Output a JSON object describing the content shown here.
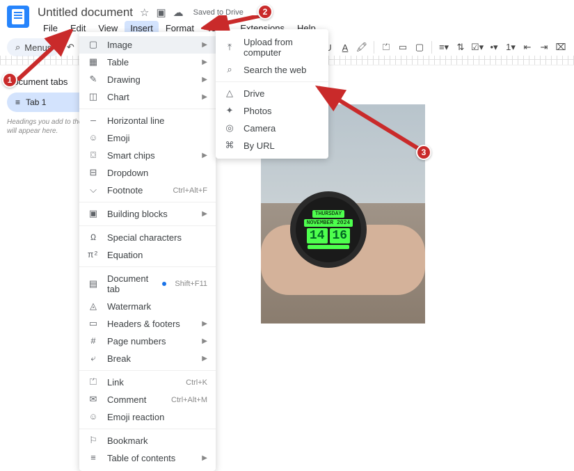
{
  "header": {
    "title": "Untitled document",
    "savedLabel": "Saved to Drive"
  },
  "menubar": {
    "items": [
      "File",
      "Edit",
      "View",
      "Insert",
      "Format",
      "Tools",
      "Extensions",
      "Help"
    ],
    "selected": "Insert"
  },
  "toolbar": {
    "searchLabel": "Menus"
  },
  "sidebar": {
    "title": "Document tabs",
    "tab1": "Tab 1",
    "hint": "Headings you add to the will appear here."
  },
  "insertMenu": {
    "items": [
      {
        "icon": "▢",
        "label": "Image",
        "arrow": true,
        "hl": true
      },
      {
        "icon": "▦",
        "label": "Table",
        "arrow": true
      },
      {
        "icon": "✎",
        "label": "Drawing",
        "arrow": true
      },
      {
        "icon": "◫",
        "label": "Chart",
        "arrow": true
      },
      {
        "sep": true
      },
      {
        "icon": "—",
        "label": "Horizontal line"
      },
      {
        "icon": "☺",
        "label": "Emoji"
      },
      {
        "icon": "⌼",
        "label": "Smart chips",
        "arrow": true
      },
      {
        "icon": "⊟",
        "label": "Dropdown"
      },
      {
        "icon": "⌵",
        "label": "Footnote",
        "shortcut": "Ctrl+Alt+F"
      },
      {
        "sep": true
      },
      {
        "icon": "▣",
        "label": "Building blocks",
        "arrow": true
      },
      {
        "sep": true
      },
      {
        "icon": "Ω",
        "label": "Special characters"
      },
      {
        "icon": "π²",
        "label": "Equation"
      },
      {
        "sep": true
      },
      {
        "icon": "▤",
        "label": "Document tab",
        "dot": true,
        "shortcut": "Shift+F11"
      },
      {
        "icon": "◬",
        "label": "Watermark"
      },
      {
        "icon": "▭",
        "label": "Headers & footers",
        "arrow": true
      },
      {
        "icon": "#",
        "label": "Page numbers",
        "arrow": true
      },
      {
        "icon": "⤶",
        "label": "Break",
        "arrow": true
      },
      {
        "sep": true
      },
      {
        "icon": "⏍",
        "label": "Link",
        "shortcut": "Ctrl+K"
      },
      {
        "icon": "✉",
        "label": "Comment",
        "shortcut": "Ctrl+Alt+M"
      },
      {
        "icon": "☺",
        "label": "Emoji reaction"
      },
      {
        "sep": true
      },
      {
        "icon": "⚐",
        "label": "Bookmark"
      },
      {
        "icon": "≡",
        "label": "Table of contents",
        "arrow": true
      }
    ]
  },
  "imageSubmenu": {
    "items": [
      {
        "icon": "⤒",
        "label": "Upload from computer"
      },
      {
        "icon": "⌕",
        "label": "Search the web"
      },
      {
        "sep": true
      },
      {
        "icon": "△",
        "label": "Drive"
      },
      {
        "icon": "✦",
        "label": "Photos"
      },
      {
        "icon": "◎",
        "label": "Camera"
      },
      {
        "icon": "⌘",
        "label": "By URL"
      }
    ]
  },
  "watch": {
    "day": "THURSDAY",
    "date": "NOVEMBER 2024",
    "hh": "14",
    "mm": "16"
  },
  "annotations": {
    "a1": "1",
    "a2": "2",
    "a3": "3"
  }
}
